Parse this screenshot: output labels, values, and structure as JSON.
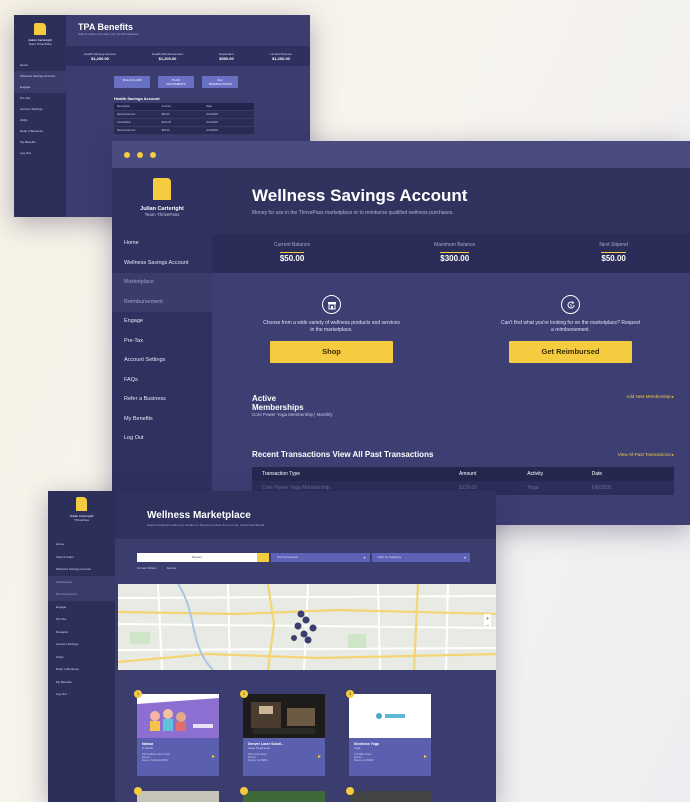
{
  "tpa": {
    "user_name": "Julian Carteright",
    "user_team": "Team ThrivePass",
    "title": "TPA Benefits",
    "subtitle": "Submit claims and view your benefit balances",
    "nav": [
      "Home",
      "Wellness Savings Account",
      "Engage",
      "Pre-Tax",
      "Account Settings",
      "FAQs",
      "Refer a Business",
      "My Benefits",
      "Log Out"
    ],
    "balances": [
      {
        "label": "Health Savings Account",
        "value": "$1,200.00"
      },
      {
        "label": "Health Reimbursement",
        "value": "$1,200.00"
      },
      {
        "label": "Dependent",
        "value": "$500.00"
      },
      {
        "label": "Limited Purpose",
        "value": "$1,200.00"
      }
    ],
    "buttons": [
      "FILE A CLAIM",
      "PLAN DOCUMENTS",
      "ALL TRANSACTIONS"
    ],
    "table_title": "Health Savings Account",
    "table_headers": [
      "Description",
      "Amount",
      "Date"
    ],
    "table_rows": [
      [
        "Reimbursement",
        "$50.00",
        "6/14/2018"
      ],
      [
        "Contribution",
        "$100.00",
        "6/12/2018"
      ],
      [
        "Reimbursement",
        "$25.00",
        "6/10/2018"
      ]
    ]
  },
  "main": {
    "user_name": "Julian Carteright",
    "user_team": "Team ThrivePass",
    "title": "Wellness Savings Account",
    "subtitle": "Money for use in the ThrivePass marketplace or to reimburse qualified wellness purchases.",
    "nav": {
      "home": "Home",
      "wsa": "Wellness Savings Account",
      "marketplace": "Marketplace",
      "reimbursement": "Reimbursement",
      "engage": "Engage",
      "pretax": "Pre-Tax",
      "settings": "Account Settings",
      "faqs": "FAQs",
      "refer": "Refer a Business",
      "benefits": "My Benefits",
      "logout": "Log Out"
    },
    "balances": {
      "current_label": "Current Balance",
      "current_value": "$50.00",
      "max_label": "Maximum Balance",
      "max_value": "$300.00",
      "next_label": "Next Stipend",
      "next_value": "$50.00"
    },
    "shop": {
      "desc": "Choose from a wide variety of wellness products and services in the marketplace.",
      "button": "Shop"
    },
    "reimburse": {
      "desc": "Can't find what you're looking for on the marketplace? Request a reimbursement.",
      "button": "Get Reimbursed"
    },
    "active": {
      "heading1": "Active",
      "heading2": "Memberships",
      "item": "Core Power Yoga Membership | Monthly",
      "link": "Add New Membership"
    },
    "recent": {
      "heading": "Recent Transactions View All Past Transactions",
      "link": "View All Past Transactions",
      "headers": [
        "Transaction Type",
        "Amount",
        "Activity",
        "Date"
      ],
      "rows": [
        [
          "Core Power Yoga Membership",
          "$129.00",
          "Yoga",
          "6/6/2018"
        ]
      ]
    },
    "colors": {
      "accent": "#f5cc3f",
      "sidebar": "#2f3160",
      "panel": "#3d3f73"
    }
  },
  "market": {
    "user_name": "Julian Carteright",
    "user_team": "ThrivePass",
    "title": "Wellness Marketplace",
    "subtitle": "Search wellness vendors by location or browse products from our list, sorted and filtered.",
    "nav": [
      "Home",
      "Submit Claim",
      "Wellness Savings Account",
      "Marketplace",
      "Reimbursement",
      "Engage",
      "Pre-Tax",
      "Rewards",
      "Account Settings",
      "FAQs",
      "Refer a Business",
      "My Benefits",
      "Log Out"
    ],
    "search_value": "Denver",
    "sort_placeholder": "Sort by Nearest",
    "category_placeholder": "Filter by Category",
    "filters": [
      "Current Filters:",
      "Denver"
    ],
    "vendors": [
      {
        "num": "1",
        "name": "Namaz",
        "category": "In Studio",
        "address": "200 Castleton Street Suite\nDenver\nDenver, Colorado 80202"
      },
      {
        "num": "2",
        "name": "Denver Laser Soluti...",
        "category": "Laser Treatments",
        "address": "100 Center Plaza\nDenver\nDenver, Co 80202"
      },
      {
        "num": "3",
        "name": "Kindness Yoga",
        "category": "Yoga",
        "address": "3 W Main Street\nDenver\nDenver, Co 80202"
      }
    ]
  }
}
